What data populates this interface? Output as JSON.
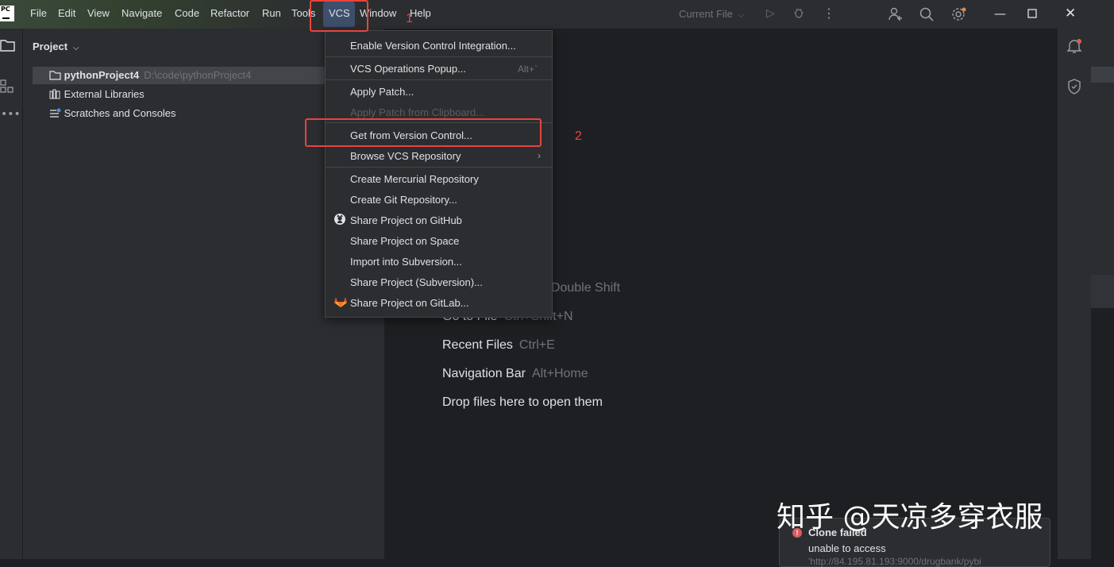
{
  "menubar": {
    "logo_text": "PC",
    "items": [
      "File",
      "Edit",
      "View",
      "Navigate",
      "Code",
      "Refactor",
      "Run",
      "Tools",
      "VCS",
      "Window",
      "Help"
    ]
  },
  "toolbar": {
    "run_config": "Current File"
  },
  "project_panel": {
    "title": "Project",
    "tree": [
      {
        "label": "pythonProject4",
        "path": "D:\\code\\pythonProject4"
      },
      {
        "label": "External Libraries"
      },
      {
        "label": "Scratches and Consoles"
      }
    ]
  },
  "vcs_menu": {
    "items": [
      {
        "label": "Enable Version Control Integration..."
      },
      {
        "label": "VCS Operations Popup...",
        "shortcut": "Alt+`"
      },
      {
        "label": "Apply Patch..."
      },
      {
        "label": "Apply Patch from Clipboard..."
      },
      {
        "label": "Get from Version Control..."
      },
      {
        "label": "Browse VCS Repository"
      },
      {
        "label": "Create Mercurial Repository"
      },
      {
        "label": "Create Git Repository..."
      },
      {
        "label": "Share Project on GitHub"
      },
      {
        "label": "Share Project on Space"
      },
      {
        "label": "Import into Subversion..."
      },
      {
        "label": "Share Project (Subversion)..."
      },
      {
        "label": "Share Project on GitLab..."
      }
    ]
  },
  "editor_hints": [
    {
      "label": "e",
      "shortcut": "Double Shift"
    },
    {
      "label": "Go to File",
      "shortcut": "Ctrl+Shift+N"
    },
    {
      "label": "Recent Files",
      "shortcut": "Ctrl+E"
    },
    {
      "label": "Navigation Bar",
      "shortcut": "Alt+Home"
    },
    {
      "label": "Drop files here to open them",
      "shortcut": ""
    }
  ],
  "annotations": {
    "step1": "1",
    "step2": "2",
    "color": "#e8443e"
  },
  "watermark": "知乎 @天凉多穿衣服",
  "notification": {
    "title": "Clone failed",
    "message": "unable to access",
    "url": "'http://84.195.81.193:9000/drugbank/pybi"
  },
  "colors": {
    "accent": "#3d4f6b",
    "error": "#db5c5c",
    "background": "#1e1f22",
    "panel": "#2b2d30"
  }
}
